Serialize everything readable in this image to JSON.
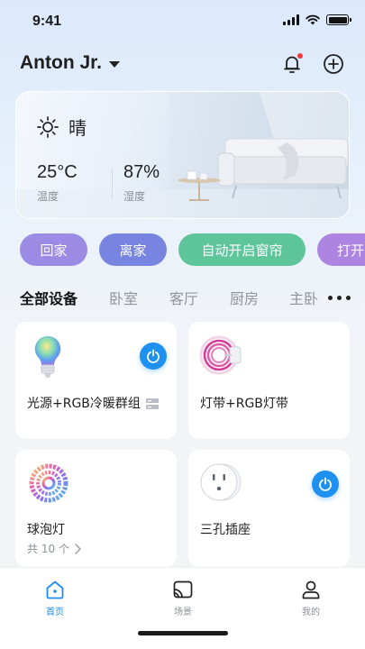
{
  "status_bar": {
    "time": "9:41"
  },
  "header": {
    "user_name": "Anton Jr."
  },
  "weather": {
    "condition": "晴",
    "temperature": {
      "value": "25°C",
      "label": "温度"
    },
    "humidity": {
      "value": "87%",
      "label": "湿度"
    }
  },
  "scenes": [
    {
      "label": "回家",
      "color": "#9c8be4"
    },
    {
      "label": "离家",
      "color": "#7785e0"
    },
    {
      "label": "自动开启窗帘",
      "color": "#5ec59a"
    },
    {
      "label": "打开",
      "color": "#ad84e2"
    }
  ],
  "tabs": [
    "全部设备",
    "卧室",
    "客厅",
    "厨房",
    "主卧"
  ],
  "devices": [
    {
      "name": "光源+RGB冷暖群组",
      "icon": "smart-bulb-icon",
      "power_on": true,
      "group_badge": true
    },
    {
      "name": "灯带+RGB灯带",
      "icon": "light-strip-icon",
      "power_on": false
    },
    {
      "name": "球泡灯",
      "icon": "rgb-ring-light-icon",
      "power_on": false,
      "count_label": "共 10 个"
    },
    {
      "name": "三孔插座",
      "icon": "socket-icon",
      "power_on": true
    }
  ],
  "bottom_nav": [
    {
      "label": "首页",
      "icon": "home-icon",
      "active": true
    },
    {
      "label": "场景",
      "icon": "scene-cast-icon",
      "active": false
    },
    {
      "label": "我的",
      "icon": "profile-icon",
      "active": false
    }
  ],
  "colors": {
    "accent": "#1e8cf0",
    "power_button": "#1e90f0",
    "notification_dot": "#ef3b3b"
  }
}
